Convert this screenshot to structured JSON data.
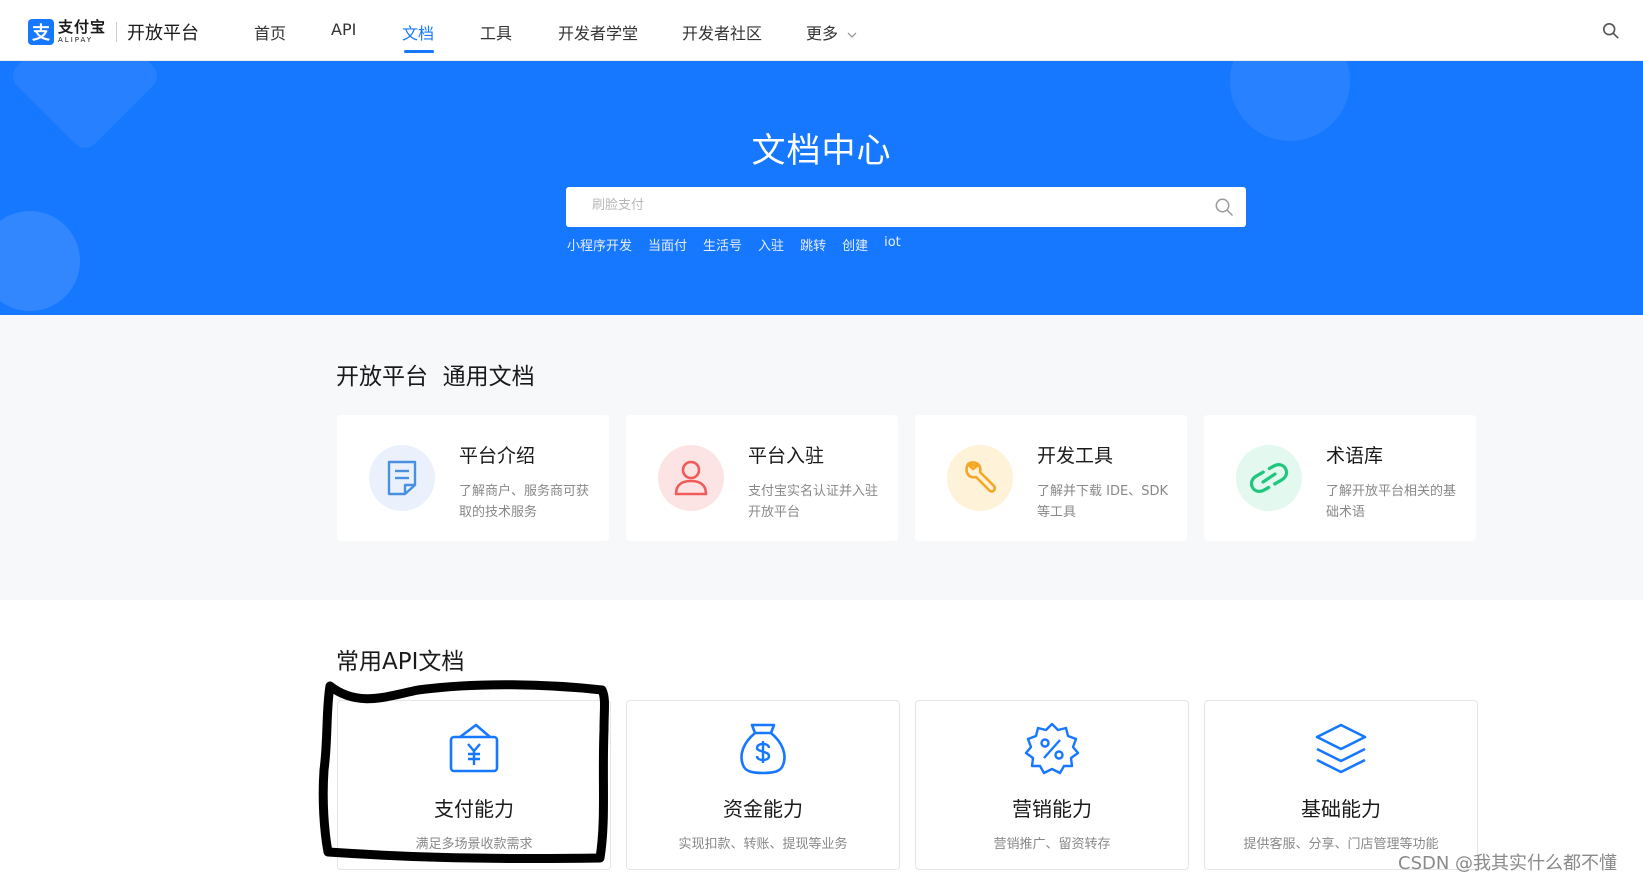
{
  "header": {
    "logo_cn": "支付宝",
    "logo_en": "ALIPAY",
    "logo_sub": "开放平台",
    "nav": [
      "首页",
      "API",
      "文档",
      "工具",
      "开发者学堂",
      "开发者社区",
      "更多"
    ],
    "active_nav": "文档",
    "accent": "#1677ff"
  },
  "hero": {
    "title": "文档中心",
    "search_placeholder": "刷脸支付",
    "hot_keywords": [
      "小程序开发",
      "当面付",
      "生活号",
      "入驻",
      "跳转",
      "创建",
      "iot"
    ]
  },
  "general_docs": {
    "title": "开放平台  通用文档",
    "cards": [
      {
        "title": "平台介绍",
        "desc": "了解商户、服务商可获取的技术服务",
        "icon": "document-icon",
        "color": "#4a90e2"
      },
      {
        "title": "平台入驻",
        "desc": "支付宝实名认证并入驻开放平台",
        "icon": "user-icon",
        "color": "#ef5a5a"
      },
      {
        "title": "开发工具",
        "desc": "了解并下载 IDE、SDK 等工具",
        "icon": "wrench-icon",
        "color": "#f5a623"
      },
      {
        "title": "术语库",
        "desc": "了解开放平台相关的基础术语",
        "icon": "link-icon",
        "color": "#1fc77e"
      }
    ]
  },
  "api_docs": {
    "title": "常用API文档",
    "cards": [
      {
        "title": "支付能力",
        "desc": "满足多场景收款需求",
        "icon": "wallet-yuan-icon"
      },
      {
        "title": "资金能力",
        "desc": "实现扣款、转账、提现等业务",
        "icon": "money-bag-icon"
      },
      {
        "title": "营销能力",
        "desc": "营销推广、留资转存",
        "icon": "discount-badge-icon"
      },
      {
        "title": "基础能力",
        "desc": "提供客服、分享、门店管理等功能",
        "icon": "layers-icon"
      }
    ]
  },
  "watermark": "CSDN @我其实什么都不懂"
}
